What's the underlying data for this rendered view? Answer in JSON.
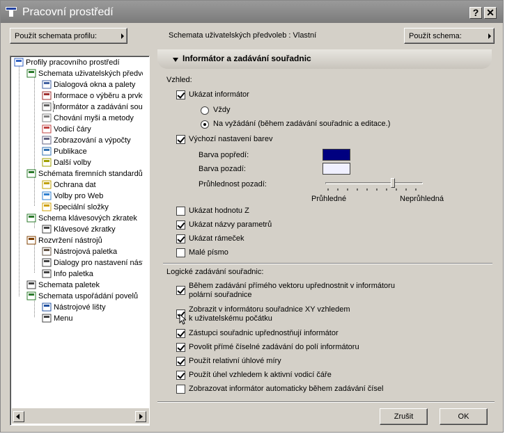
{
  "window": {
    "title": "Pracovní prostředí",
    "help_label": "?",
    "close_label": "✕"
  },
  "toolbar": {
    "use_profile_label": "Použít schemata profilu:",
    "current_scheme_label": "Schemata uživatelských předvoleb : Vlastní",
    "use_scheme_label": "Použít schema:"
  },
  "tree": {
    "items": [
      {
        "label": "Profily pracovního prostředí",
        "icon": "profiles-icon"
      },
      {
        "label": "Schemata uživatelských předvoleb",
        "icon": "user-schemes-icon"
      },
      {
        "label": "Dialogová okna a palety",
        "icon": "dialog-palettes-icon"
      },
      {
        "label": "Informace o výběru a prvku",
        "icon": "selection-info-icon"
      },
      {
        "label": "Informátor a zadávání souřadnic",
        "icon": "info-box-icon"
      },
      {
        "label": "Chování myši a metody",
        "icon": "mouse-icon"
      },
      {
        "label": "Vodicí čáry",
        "icon": "guide-lines-icon"
      },
      {
        "label": "Zobrazování a výpočty",
        "icon": "display-calc-icon"
      },
      {
        "label": "Publikace",
        "icon": "publish-icon"
      },
      {
        "label": "Další volby",
        "icon": "more-options-icon"
      },
      {
        "label": "Schémata firemních standardů",
        "icon": "company-schemes-icon"
      },
      {
        "label": "Ochrana dat",
        "icon": "data-protection-icon"
      },
      {
        "label": "Volby pro Web",
        "icon": "web-globe-icon"
      },
      {
        "label": "Speciální složky",
        "icon": "special-folders-icon"
      },
      {
        "label": "Schema klávesových zkratek",
        "icon": "shortcut-schemes-icon"
      },
      {
        "label": "Klávesové zkratky",
        "icon": "keyboard-shortcut-icon"
      },
      {
        "label": "Rozvržení nástrojů",
        "icon": "tool-layout-icon"
      },
      {
        "label": "Nástrojová paletka",
        "icon": "toolbox-icon"
      },
      {
        "label": "Dialogy pro nastavení nástrojů",
        "icon": "tool-settings-icon"
      },
      {
        "label": "Info paletka",
        "icon": "info-palette-icon"
      },
      {
        "label": "Schemata paletek",
        "icon": "palette-schemes-icon"
      },
      {
        "label": "Schemata uspořádání povelů",
        "icon": "command-layout-icon"
      },
      {
        "label": "Nástrojové lišty",
        "icon": "toolbars-icon"
      },
      {
        "label": "Menu",
        "icon": "menu-icon"
      }
    ]
  },
  "panel": {
    "header": "Informátor a zadávání souřadnic",
    "appearance_label": "Vzhled:",
    "show_infobox": "Ukázat informátor",
    "always": "Vždy",
    "on_demand": "Na vyžádání (během zadávání souřadnic a editace.)",
    "default_colors": "Výchozí nastavení barev",
    "fg_color_label": "Barva popředí:",
    "bg_color_label": "Barva pozadí:",
    "fg_color": "#000080",
    "bg_color": "#f0f0ff",
    "transparency_label": "Průhlednost pozadí:",
    "transparency_min": "Průhledné",
    "transparency_max": "Neprůhledná",
    "transparency_value": 0.7,
    "show_z": "Ukázat hodnotu Z",
    "show_param_names": "Ukázat názvy parametrů",
    "show_frame": "Ukázat rámeček",
    "small_font": "Malé písmo",
    "logical_label": "Logické zadávání souřadnic:",
    "opt_polar_1": "Během zadávání přímého vektoru upřednostnit v informátoru",
    "opt_polar_2": "polární souřadnice",
    "opt_xy_1": "Zobrazit v informátoru souřadnice XY vzhledem",
    "opt_xy_2": "k uživatelskému počátku",
    "opt_substitute": "Zástupci souřadnic upřednostňují informátor",
    "opt_direct": "Povolit přímé číselné zadávání do polí informátoru",
    "opt_relative": "Použít relativní úhlové míry",
    "opt_angle": "Použít úhel vzhledem k aktivní vodicí čáře",
    "opt_auto": "Zobrazovat informátor automaticky během zadávání čísel"
  },
  "footer": {
    "cancel_label": "Zrušit",
    "ok_label": "OK"
  }
}
